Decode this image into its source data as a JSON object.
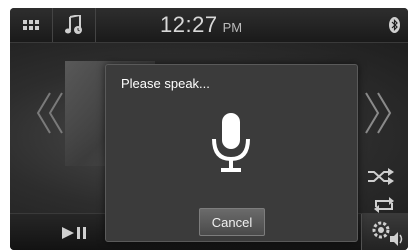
{
  "statusbar": {
    "menu_icon": "grid-menu-icon",
    "source_icon": "music-note-icon",
    "time": "12:27",
    "ampm": "PM",
    "bluetooth_icon": "bluetooth-icon"
  },
  "player": {
    "prev_icon": "chevron-left-icon",
    "next_icon": "chevron-right-icon",
    "shuffle_icon": "shuffle-icon",
    "repeat_icon": "repeat-icon"
  },
  "bottombar": {
    "play_pause_icon": "play-pause-icon",
    "settings_icon": "audio-settings-icon"
  },
  "dialog": {
    "title": "Please speak...",
    "mic_icon": "microphone-icon",
    "cancel_label": "Cancel"
  },
  "colors": {
    "background": "#1c1c1c",
    "dialog": "#3b3b3b",
    "text": "#ffffff"
  }
}
